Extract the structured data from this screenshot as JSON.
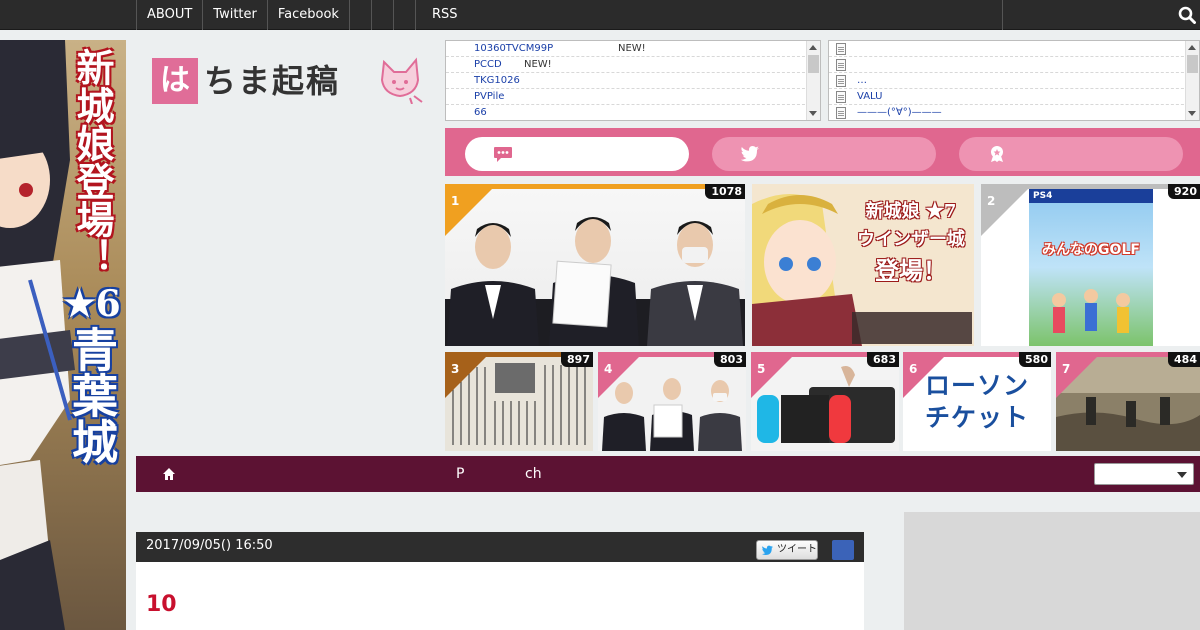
{
  "topnav": {
    "items": [
      "ABOUT",
      "Twitter",
      "Facebook",
      "",
      "",
      "",
      "RSS"
    ]
  },
  "side_ad": {
    "line1": "新城娘登場！",
    "star": "★6",
    "line2": "青葉城"
  },
  "logo": {
    "box_char": "は",
    "text": "ちま起稿"
  },
  "feed_left": [
    {
      "title": "10360TVCM99P",
      "badge": "NEW!"
    },
    {
      "title": "PCCD",
      "badge": "NEW!"
    },
    {
      "title": "TKG1026",
      "badge": ""
    },
    {
      "title": "PVPile",
      "badge": ""
    },
    {
      "title": "66",
      "badge": ""
    }
  ],
  "feed_right": [
    {
      "title": ""
    },
    {
      "title": ""
    },
    {
      "title": "…"
    },
    {
      "title": "VALU"
    },
    {
      "title": "———(°∀°)———"
    }
  ],
  "tabs": [
    {
      "icon": "comment-icon",
      "active": true
    },
    {
      "icon": "twitter-icon",
      "active": false
    },
    {
      "icon": "ranking-badge-icon",
      "active": false
    }
  ],
  "ranking": [
    {
      "rank": "1",
      "count": "1078",
      "color": "#f0a020"
    },
    {
      "rank": "",
      "count": "",
      "color": ""
    },
    {
      "rank": "2",
      "count": "920",
      "color": "#bdbdbd"
    },
    {
      "rank": "3",
      "count": "897",
      "color": "#a6611a"
    },
    {
      "rank": "4",
      "count": "803",
      "color": "#e0678f"
    },
    {
      "rank": "5",
      "count": "683",
      "color": "#e0678f"
    },
    {
      "rank": "6",
      "count": "580",
      "color": "#e0678f"
    },
    {
      "rank": "7",
      "count": "484",
      "color": "#e0678f"
    }
  ],
  "ad_banner": {
    "line1": "新城娘 ★7",
    "line2": "ウインザー城",
    "line3": "登場！"
  },
  "game_cover": {
    "platform": "PS4",
    "title": "みんなのGOLF"
  },
  "lawson": {
    "line1": "ローソン",
    "line2": "チケット"
  },
  "darknav": {
    "item1": "P",
    "item2": "ch",
    "select_value": ""
  },
  "article": {
    "date": "2017/09/05() 16:50",
    "tweet_label": "ツイート",
    "title": "10"
  },
  "colors": {
    "accent_pink": "#e0678f",
    "dark_nav": "#5c1233",
    "title_red": "#c8102e",
    "link_blue": "#1a3fa8"
  }
}
